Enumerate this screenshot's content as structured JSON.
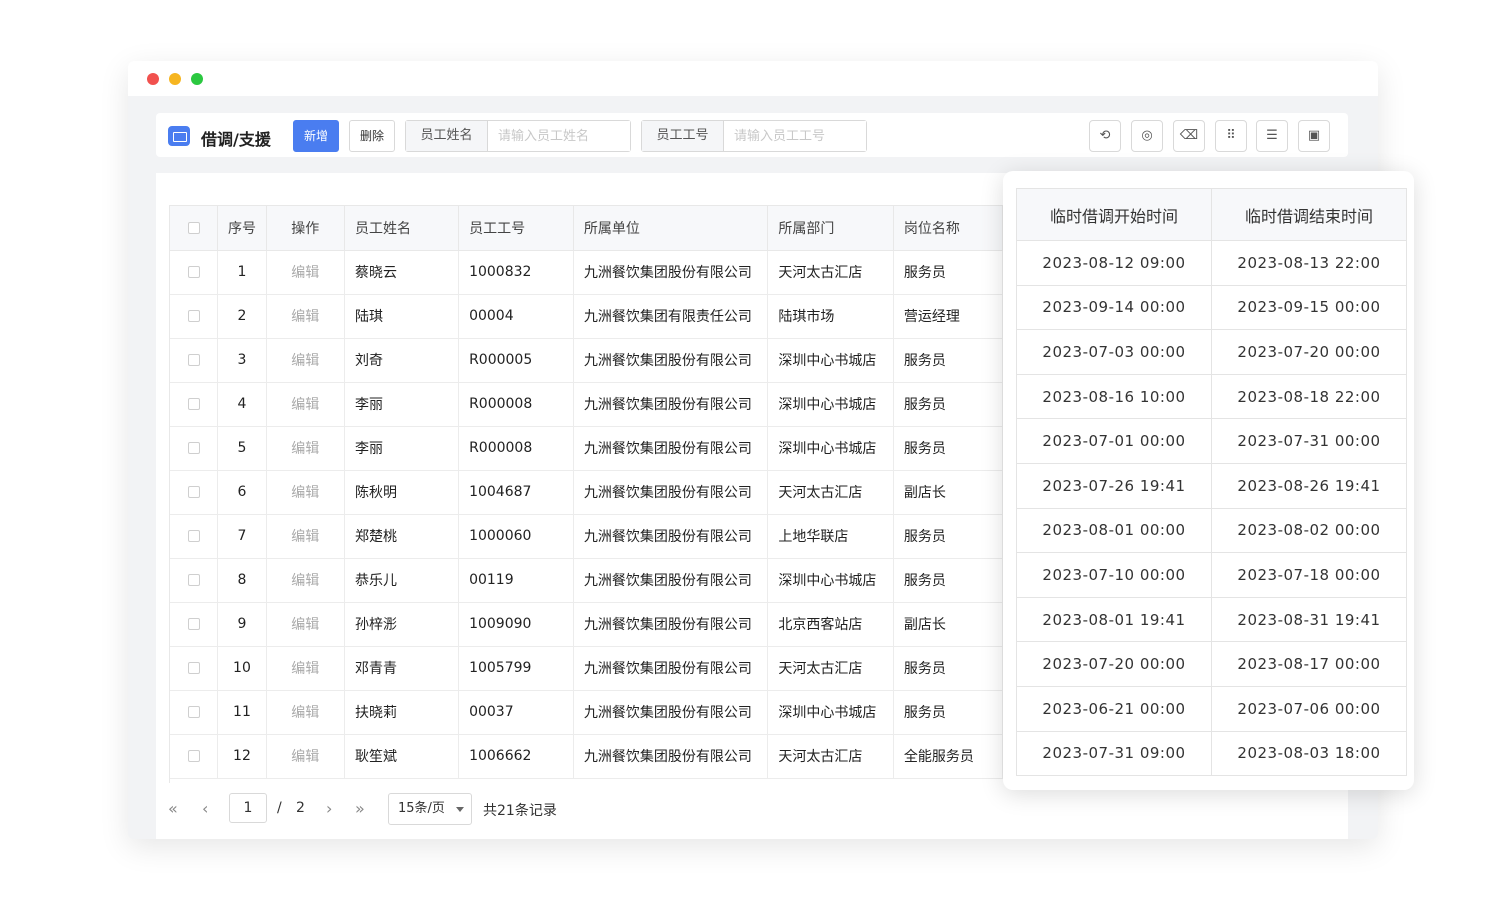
{
  "toolbar": {
    "title": "借调/支援",
    "add_label": "新增",
    "delete_label": "删除",
    "name_search": {
      "label": "员工姓名",
      "placeholder": "请输入员工姓名"
    },
    "id_search": {
      "label": "员工工号",
      "placeholder": "请输入员工工号"
    },
    "tools": [
      "refresh-icon",
      "target-icon",
      "clear-icon",
      "grid-icon",
      "list-icon",
      "fullscreen-icon"
    ]
  },
  "table": {
    "headers": {
      "index": "序号",
      "op": "操作",
      "name": "员工姓名",
      "emp_id": "员工工号",
      "company": "所属单位",
      "dept": "所属部门",
      "position": "岗位名称"
    },
    "op_label": "编辑",
    "rows": [
      {
        "index": "1",
        "name": "蔡晓云",
        "emp_id": "1000832",
        "company": "九洲餐饮集团股份有限公司",
        "dept": "天河太古汇店",
        "position": "服务员"
      },
      {
        "index": "2",
        "name": "陆琪",
        "emp_id": "00004",
        "company": "九洲餐饮集团有限责任公司",
        "dept": "陆琪市场",
        "position": "营运经理"
      },
      {
        "index": "3",
        "name": "刘奇",
        "emp_id": "R000005",
        "company": "九洲餐饮集团股份有限公司",
        "dept": "深圳中心书城店",
        "position": "服务员"
      },
      {
        "index": "4",
        "name": "李丽",
        "emp_id": "R000008",
        "company": "九洲餐饮集团股份有限公司",
        "dept": "深圳中心书城店",
        "position": "服务员"
      },
      {
        "index": "5",
        "name": "李丽",
        "emp_id": "R000008",
        "company": "九洲餐饮集团股份有限公司",
        "dept": "深圳中心书城店",
        "position": "服务员"
      },
      {
        "index": "6",
        "name": "陈秋明",
        "emp_id": "1004687",
        "company": "九洲餐饮集团股份有限公司",
        "dept": "天河太古汇店",
        "position": "副店长"
      },
      {
        "index": "7",
        "name": "郑楚桃",
        "emp_id": "1000060",
        "company": "九洲餐饮集团股份有限公司",
        "dept": "上地华联店",
        "position": "服务员"
      },
      {
        "index": "8",
        "name": "恭乐儿",
        "emp_id": "00119",
        "company": "九洲餐饮集团股份有限公司",
        "dept": "深圳中心书城店",
        "position": "服务员"
      },
      {
        "index": "9",
        "name": "孙梓浵",
        "emp_id": "1009090",
        "company": "九洲餐饮集团股份有限公司",
        "dept": "北京西客站店",
        "position": "副店长"
      },
      {
        "index": "10",
        "name": "邓青青",
        "emp_id": "1005799",
        "company": "九洲餐饮集团股份有限公司",
        "dept": "天河太古汇店",
        "position": "服务员"
      },
      {
        "index": "11",
        "name": "扶晓莉",
        "emp_id": "00037",
        "company": "九洲餐饮集团股份有限公司",
        "dept": "深圳中心书城店",
        "position": "服务员"
      },
      {
        "index": "12",
        "name": "耿笙斌",
        "emp_id": "1006662",
        "company": "九洲餐饮集团股份有限公司",
        "dept": "天河太古汇店",
        "position": "全能服务员"
      }
    ]
  },
  "pager": {
    "current": "1",
    "separator": "/",
    "total_pages": "2",
    "page_size": "15条/页",
    "total": "共21条记录"
  },
  "time_table": {
    "headers": {
      "start": "临时借调开始时间",
      "end": "临时借调结束时间"
    },
    "rows": [
      {
        "start": "2023-08-12 09:00",
        "end": "2023-08-13 22:00"
      },
      {
        "start": "2023-09-14 00:00",
        "end": "2023-09-15 00:00"
      },
      {
        "start": "2023-07-03 00:00",
        "end": "2023-07-20 00:00"
      },
      {
        "start": "2023-08-16 10:00",
        "end": "2023-08-18 22:00"
      },
      {
        "start": "2023-07-01 00:00",
        "end": "2023-07-31 00:00"
      },
      {
        "start": "2023-07-26 19:41",
        "end": "2023-08-26 19:41"
      },
      {
        "start": "2023-08-01 00:00",
        "end": "2023-08-02 00:00"
      },
      {
        "start": "2023-07-10 00:00",
        "end": "2023-07-18 00:00"
      },
      {
        "start": "2023-08-01 19:41",
        "end": "2023-08-31 19:41"
      },
      {
        "start": "2023-07-20 00:00",
        "end": "2023-08-17 00:00"
      },
      {
        "start": "2023-06-21 00:00",
        "end": "2023-07-06 00:00"
      },
      {
        "start": "2023-07-31 09:00",
        "end": "2023-08-03 18:00"
      }
    ]
  },
  "colors": {
    "primary": "#4a7df0",
    "dot_red": "#f1514e",
    "dot_yellow": "#f6b520",
    "dot_green": "#2bc840"
  }
}
